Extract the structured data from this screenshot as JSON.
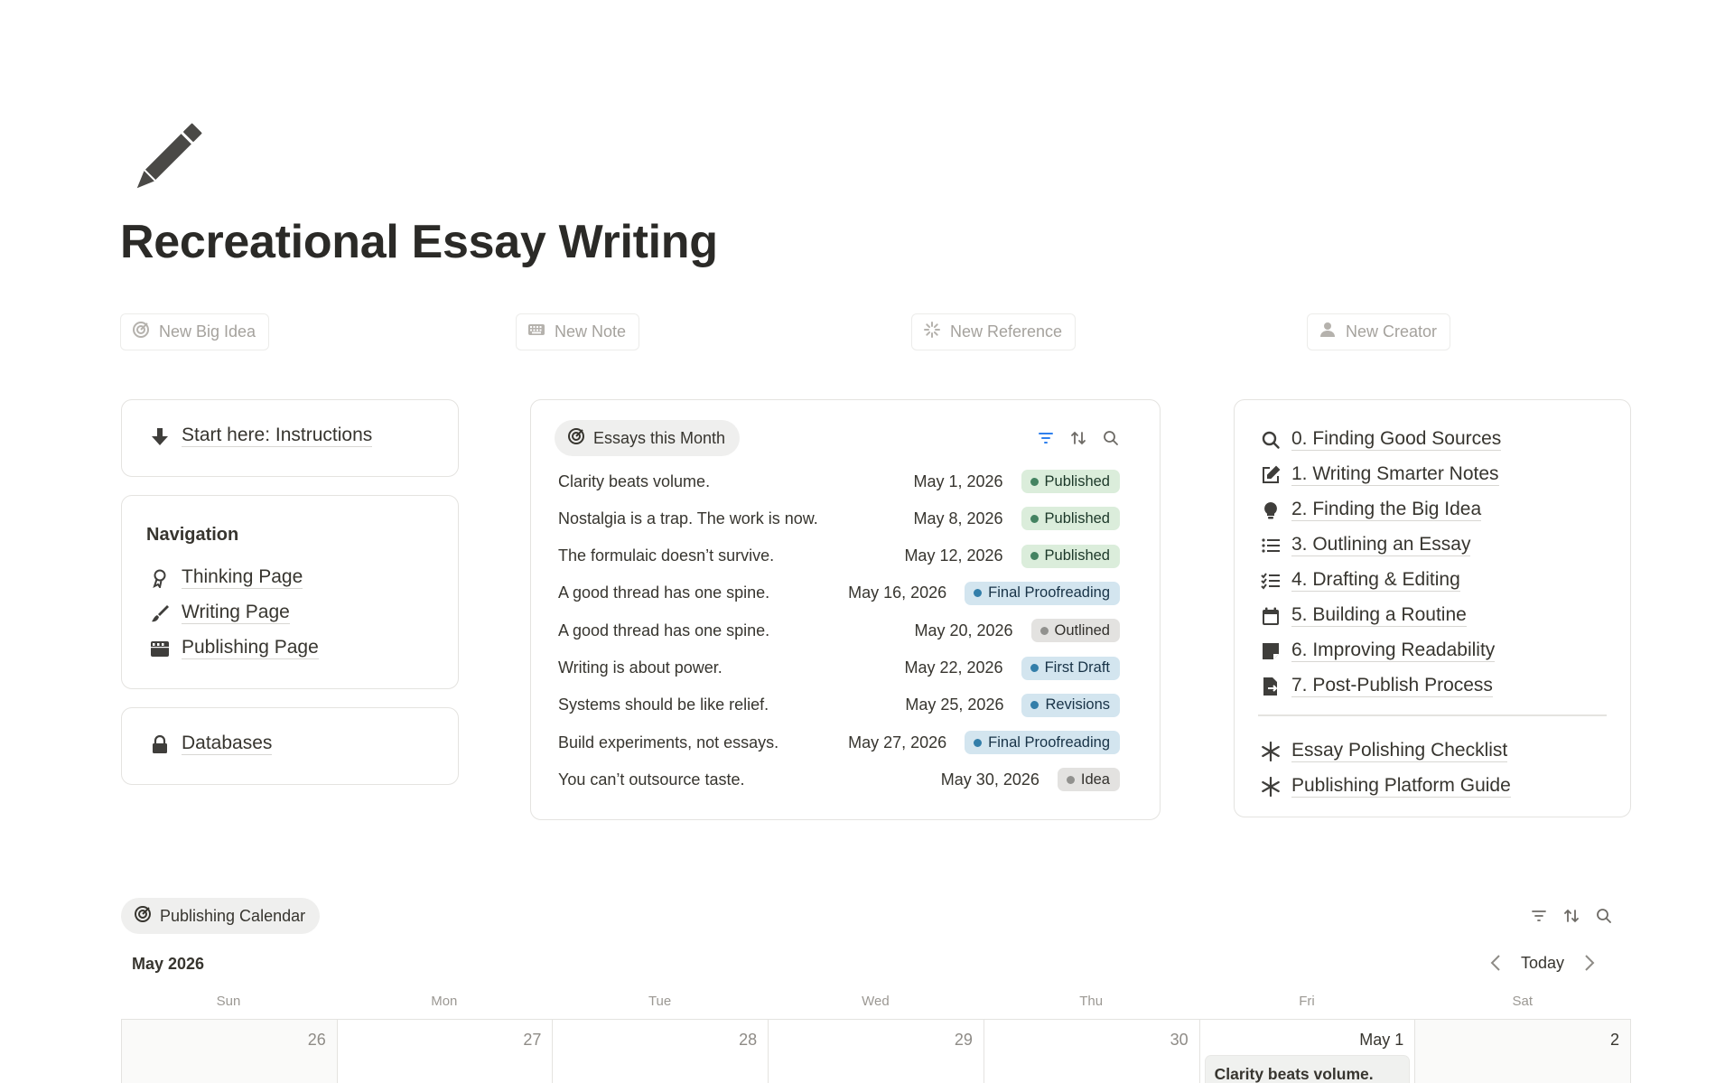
{
  "page": {
    "icon": "pencil-icon",
    "title": "Recreational Essay Writing"
  },
  "quick_actions": [
    {
      "label": "New Big Idea",
      "icon": "target-icon"
    },
    {
      "label": "New Note",
      "icon": "keyboard-icon"
    },
    {
      "label": "New Reference",
      "icon": "sparkle-loader-icon"
    },
    {
      "label": "New Creator",
      "icon": "person-icon"
    }
  ],
  "start_here": {
    "label": "Start here: Instructions",
    "icon": "arrow-down-icon"
  },
  "navigation": {
    "title": "Navigation",
    "items": [
      {
        "label": "Thinking Page",
        "icon": "ribbon-icon"
      },
      {
        "label": "Writing Page",
        "icon": "brush-icon"
      },
      {
        "label": "Publishing Page",
        "icon": "clapperboard-icon"
      }
    ]
  },
  "databases": {
    "label": "Databases",
    "icon": "lock-icon"
  },
  "essays": {
    "title": "Essays this Month",
    "toolbar": [
      "filter-icon",
      "sort-icon",
      "search-icon"
    ],
    "rows": [
      {
        "title": "Clarity beats volume.",
        "date": "May 1, 2026",
        "status": "Published"
      },
      {
        "title": "Nostalgia is a trap. The work is now.",
        "date": "May 8, 2026",
        "status": "Published"
      },
      {
        "title": "The formulaic doesn’t survive.",
        "date": "May 12, 2026",
        "status": "Published"
      },
      {
        "title": "A good thread has one spine.",
        "date": "May 16, 2026",
        "status": "Final Proofreading"
      },
      {
        "title": "A good thread has one spine.",
        "date": "May 20, 2026",
        "status": "Outlined"
      },
      {
        "title": "Writing is about power.",
        "date": "May 22, 2026",
        "status": "First Draft"
      },
      {
        "title": "Systems should be like relief.",
        "date": "May 25, 2026",
        "status": "Revisions"
      },
      {
        "title": "Build experiments, not essays.",
        "date": "May 27, 2026",
        "status": "Final Proofreading"
      },
      {
        "title": "You can’t outsource taste.",
        "date": "May 30, 2026",
        "status": "Idea"
      }
    ],
    "status_colors": {
      "Published": {
        "bg": "#dbeddb",
        "dot": "#448361",
        "text": "#1c3829"
      },
      "Final Proofreading": {
        "bg": "#d3e5ef",
        "dot": "#337ea9",
        "text": "#183347"
      },
      "Outlined": {
        "bg": "#e3e2e0",
        "dot": "#91918e",
        "text": "#32302c"
      },
      "First Draft": {
        "bg": "#d3e5ef",
        "dot": "#337ea9",
        "text": "#183347"
      },
      "Revisions": {
        "bg": "#d3e5ef",
        "dot": "#337ea9",
        "text": "#183347"
      },
      "Idea": {
        "bg": "#e3e2e0",
        "dot": "#91918e",
        "text": "#32302c"
      }
    }
  },
  "guides": {
    "items": [
      {
        "label": "0. Finding Good Sources",
        "icon": "search-icon"
      },
      {
        "label": "1. Writing Smarter Notes",
        "icon": "edit-note-icon"
      },
      {
        "label": "2. Finding the Big Idea",
        "icon": "lightbulb-icon"
      },
      {
        "label": "3. Outlining an Essay",
        "icon": "list-icon"
      },
      {
        "label": "4. Drafting & Editing",
        "icon": "checklist-icon"
      },
      {
        "label": "5. Building a Routine",
        "icon": "calendar-icon"
      },
      {
        "label": "6. Improving Readability",
        "icon": "sticky-note-icon"
      },
      {
        "label": "7. Post-Publish Process",
        "icon": "file-export-icon"
      }
    ],
    "extras": [
      {
        "label": "Essay Polishing Checklist",
        "icon": "asterisk-icon"
      },
      {
        "label": "Publishing Platform Guide",
        "icon": "asterisk-icon"
      }
    ]
  },
  "calendar": {
    "title": "Publishing Calendar",
    "month": "May 2026",
    "today_label": "Today",
    "toolbar": [
      "filter-icon",
      "sort-icon",
      "search-icon"
    ],
    "weekdays": [
      "Sun",
      "Mon",
      "Tue",
      "Wed",
      "Thu",
      "Fri",
      "Sat"
    ],
    "first_week": [
      "26",
      "27",
      "28",
      "29",
      "30",
      "May 1",
      "2"
    ],
    "events": [
      {
        "day": "May 1",
        "title": "Clarity beats volume."
      }
    ]
  }
}
